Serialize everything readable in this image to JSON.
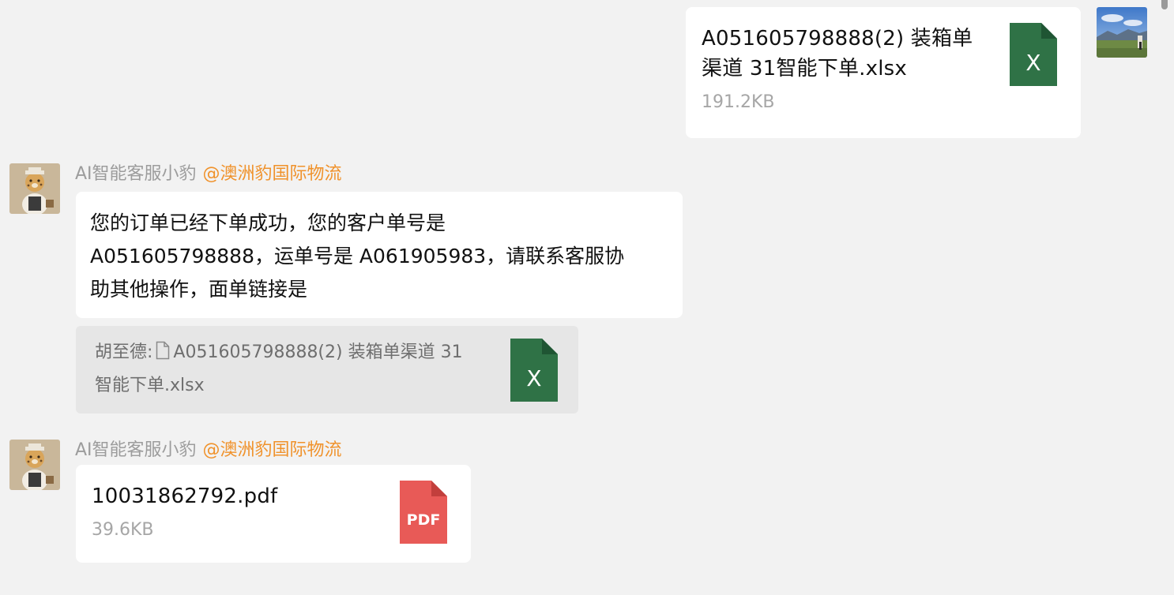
{
  "messages": {
    "outgoing_file": {
      "name_line1": "A051605798888(2) 装箱单",
      "name_line2": "渠道 31智能下单.xlsx",
      "size": "191.2KB",
      "icon_label": "X",
      "icon_color": "#2f7246"
    },
    "reply1": {
      "sender": "AI智能客服小豹",
      "org": "@澳洲豹国际物流",
      "line1": "您的订单已经下单成功，您的客户单号是",
      "line2": "A051605798888，运单号是 A061905983，请联系客服协",
      "line3": "助其他操作，面单链接是"
    },
    "quote": {
      "author": "胡至德:",
      "file_line1": "A051605798888(2) 装箱单渠道 31",
      "file_line2": "智能下单.xlsx",
      "icon_label": "X"
    },
    "reply2": {
      "sender": "AI智能客服小豹",
      "org": "@澳洲豹国际物流",
      "file_name": "10031862792.pdf",
      "size": "39.6KB",
      "icon_label": "PDF",
      "icon_color": "#e85a57"
    }
  },
  "colors": {
    "background": "#f2f2f2",
    "bubble": "#ffffff",
    "quote_bg": "#e6e6e6",
    "org_accent": "#f0922b"
  }
}
